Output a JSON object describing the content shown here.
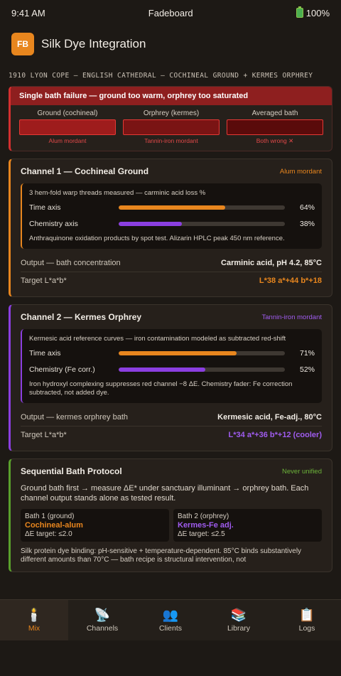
{
  "status": {
    "time": "9:41 AM",
    "carrier": "Fadeboard",
    "battery": "100%"
  },
  "app": {
    "logo": "FB",
    "title": "Silk Dye Integration"
  },
  "subtitle": "1910 LYON COPE — ENGLISH CATHEDRAL — COCHINEAL GROUND + KERMES ORPHREY",
  "failure": {
    "headline": "Single bath failure — ground too warm, orphrey too saturated",
    "swatches": [
      {
        "label": "Ground (cochineal)",
        "caption": "Alum mordant",
        "color": "#9e1c1c"
      },
      {
        "label": "Orphrey (kermes)",
        "caption": "Tannin-iron mordant",
        "color": "#7a1414"
      },
      {
        "label": "Averaged bath",
        "caption": "Both wrong ✕",
        "color": "#5a0b0b"
      }
    ]
  },
  "channel1": {
    "title": "Channel 1 — Cochineal Ground",
    "tag": "Alum mordant",
    "caption": "3 hem-fold warp threads measured — carminic acid loss %",
    "bars": [
      {
        "label": "Time axis",
        "value": "64%",
        "fraction": 0.64,
        "color": "orange"
      },
      {
        "label": "Chemistry axis",
        "value": "38%",
        "fraction": 0.38,
        "color": "purple"
      }
    ],
    "note": "Anthraquinone oxidation products by spot test. Alizarin HPLC peak 450 nm reference.",
    "output_label": "Output — bath concentration",
    "output_value": "Carminic acid, pH 4.2, 85°C",
    "target_label": "Target L*a*b*",
    "target_value": "L*38 a*+44 b*+18"
  },
  "channel2": {
    "title": "Channel 2 — Kermes Orphrey",
    "tag": "Tannin-iron mordant",
    "caption": "Kermesic acid reference curves — iron contamination modeled as subtracted red-shift",
    "bars": [
      {
        "label": "Time axis",
        "value": "71%",
        "fraction": 0.71,
        "color": "orange"
      },
      {
        "label": "Chemistry (Fe corr.)",
        "value": "52%",
        "fraction": 0.52,
        "color": "purple"
      }
    ],
    "note": "Iron hydroxyl complexing suppresses red channel −8 ΔE. Chemistry fader: Fe correction subtracted, not added dye.",
    "output_label": "Output — kermes orphrey bath",
    "output_value": "Kermesic acid, Fe-adj., 80°C",
    "target_label": "Target L*a*b*",
    "target_value": "L*34 a*+36 b*+12 (cooler)"
  },
  "protocol": {
    "title": "Sequential Bath Protocol",
    "tag": "Never unified",
    "text": "Ground bath first → measure ΔE* under sanctuary illuminant → orphrey bath. Each channel output stands alone as tested result.",
    "baths": [
      {
        "name": "Bath 1 (ground)",
        "dye": "Cochineal-alum",
        "target": "ΔE target: ≤2.0",
        "color": "orange"
      },
      {
        "name": "Bath 2 (orphrey)",
        "dye": "Kermes-Fe adj.",
        "target": "ΔE target: ≤2.5",
        "color": "purple"
      }
    ],
    "footer": "Silk protein dye binding: pH-sensitive + temperature-dependent. 85°C binds substantively different amounts than 70°C — bath recipe is structural intervention, not"
  },
  "tabs": [
    {
      "label": "Mix",
      "icon": "mix-icon",
      "glyph": "🕯️",
      "active": true
    },
    {
      "label": "Channels",
      "icon": "channels-icon",
      "glyph": "📡",
      "active": false
    },
    {
      "label": "Clients",
      "icon": "clients-icon",
      "glyph": "👥",
      "active": false
    },
    {
      "label": "Library",
      "icon": "library-icon",
      "glyph": "📚",
      "active": false
    },
    {
      "label": "Logs",
      "icon": "logs-icon",
      "glyph": "📋",
      "active": false
    }
  ]
}
